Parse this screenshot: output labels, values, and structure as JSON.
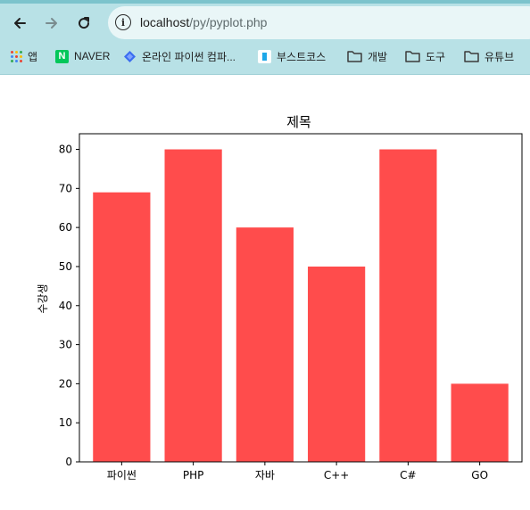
{
  "browser": {
    "url_host": "localhost",
    "url_path": "/py/pyplot.php",
    "bookmarks": [
      {
        "label": "앱",
        "icon": "apps-grid-icon"
      },
      {
        "label": "NAVER",
        "icon": "naver-icon"
      },
      {
        "label": "온라인 파이썬 컴파...",
        "icon": "diamond-icon"
      },
      {
        "label": "부스트코스",
        "icon": "boostcourse-icon"
      },
      {
        "label": "개발",
        "icon": "folder-icon"
      },
      {
        "label": "도구",
        "icon": "folder-icon"
      },
      {
        "label": "유튜브",
        "icon": "folder-icon"
      }
    ]
  },
  "chart_data": {
    "type": "bar",
    "title": "제목",
    "xlabel": "",
    "ylabel": "수강생",
    "categories": [
      "파이썬",
      "PHP",
      "자바",
      "C++",
      "C#",
      "GO"
    ],
    "values": [
      69,
      80,
      60,
      50,
      80,
      20
    ],
    "ylim": [
      0,
      84
    ],
    "yticks": [
      0,
      10,
      20,
      30,
      40,
      50,
      60,
      70,
      80
    ],
    "bar_color": "#ff4c4c",
    "grid": false
  }
}
